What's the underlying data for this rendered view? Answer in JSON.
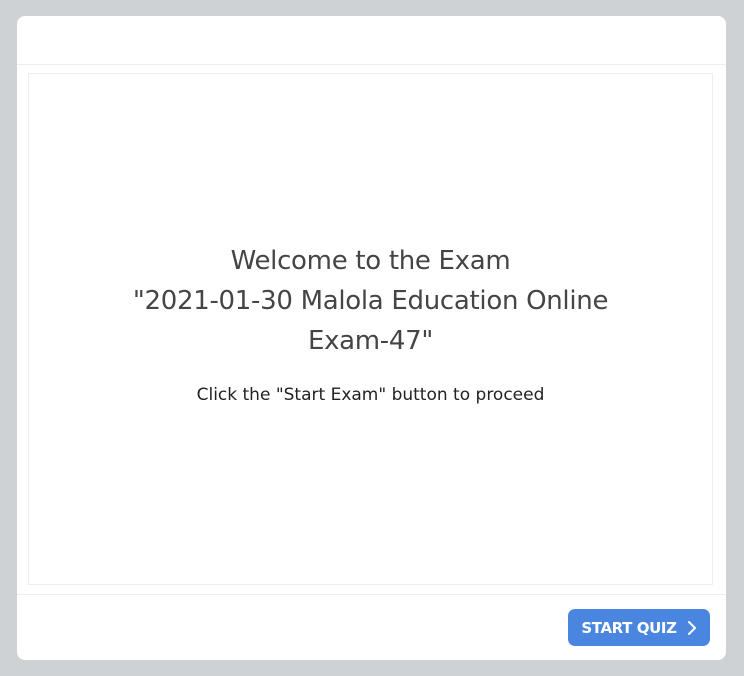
{
  "exam": {
    "title_line1": "Welcome to the Exam",
    "title_line2": "\"2021-01-30 Malola Education Online Exam-47\"",
    "instruction": "Click the \"Start Exam\" button to proceed"
  },
  "footer": {
    "start_label": "START QUIZ",
    "start_icon": "chevron-right-icon"
  },
  "colors": {
    "page_background": "#cfd2d5",
    "card_background": "#ffffff",
    "button_background": "#4a86e0",
    "title_text": "#454545"
  }
}
